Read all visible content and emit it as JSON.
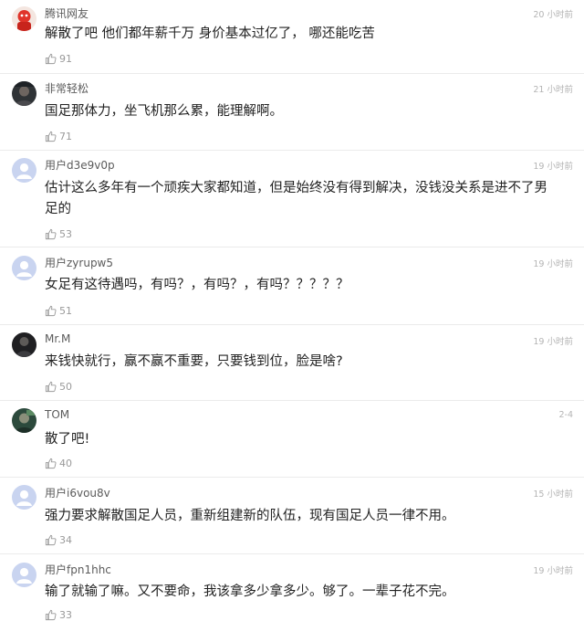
{
  "comments": [
    {
      "user": "腾讯网友",
      "time": "20 小时前",
      "text": "解散了吧 他们都年薪千万 身价基本过亿了， 哪还能吃苦",
      "likes": "91",
      "avatar": "red-character"
    },
    {
      "user": "非常轻松",
      "time": "21 小时前",
      "text": "国足那体力，坐飞机那么累，能理解啊。",
      "likes": "71",
      "avatar": "photo-dark"
    },
    {
      "user": "用户d3e9v0p",
      "time": "19 小时前",
      "text": "估计这么多年有一个顽疾大家都知道，但是始终没有得到解决，没钱没关系是进不了男足的",
      "likes": "53",
      "avatar": "default"
    },
    {
      "user": "用户zyrupw5",
      "time": "19 小时前",
      "text": "女足有这待遇吗，有吗？，有吗？，有吗？？？？？",
      "likes": "51",
      "avatar": "default"
    },
    {
      "user": "Mr.M",
      "time": "19 小时前",
      "text": "来钱快就行，赢不赢不重要，只要钱到位，脸是啥?",
      "likes": "50",
      "avatar": "photo-dark"
    },
    {
      "user": "TOM",
      "time": "2-4",
      "text": "散了吧!",
      "likes": "40",
      "avatar": "photo-green"
    },
    {
      "user": "用户i6vou8v",
      "time": "15 小时前",
      "text": "强力要求解散国足人员，重新组建新的队伍，现有国足人员一律不用。",
      "likes": "34",
      "avatar": "default"
    },
    {
      "user": "用户fpn1hhc",
      "time": "19 小时前",
      "text": "输了就输了嘛。又不要命，我该拿多少拿多少。够了。一辈子花不完。",
      "likes": "33",
      "avatar": "default"
    }
  ],
  "icons": {
    "like": "thumbs-up-icon",
    "avatar_default": "default-user-icon"
  },
  "colors": {
    "username": "#5b5b5b",
    "text": "#222222",
    "meta": "#b4b4b4",
    "avatar_default": "#c9d4f0"
  }
}
